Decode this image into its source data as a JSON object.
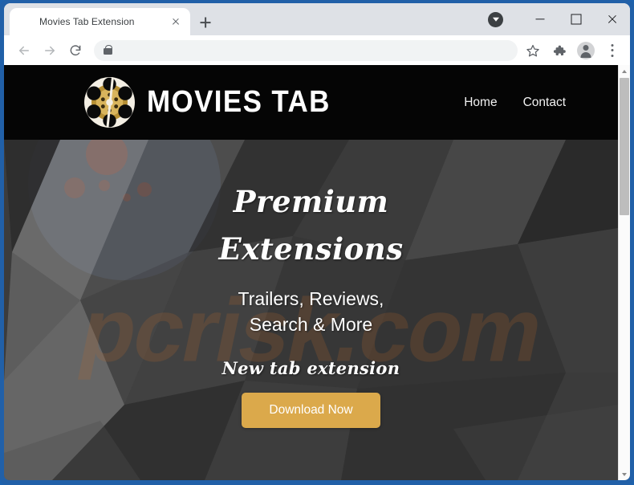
{
  "browser": {
    "tab": {
      "title": "Movies Tab Extension",
      "favicon": "film-reel-icon",
      "close_label": "×"
    },
    "new_tab_label": "+",
    "window_controls": {
      "download_badge": "download-indicator",
      "minimize": "–",
      "maximize": "□",
      "close": "×"
    },
    "toolbar": {
      "back": "back-arrow",
      "forward": "forward-arrow",
      "reload": "reload-arrow",
      "omnibox_value": "",
      "omnibox_placeholder": "",
      "lock": "lock-icon",
      "bookmark": "star-icon",
      "extensions": "puzzle-icon",
      "profile": "profile-avatar",
      "menu": "three-dot-menu"
    }
  },
  "site": {
    "brand": {
      "name": "MOVIES TAB",
      "logo": "film-reel-logo"
    },
    "nav": [
      {
        "label": "Home"
      },
      {
        "label": "Contact"
      }
    ],
    "hero": {
      "headline_line1": "Premium",
      "headline_line2": "Extensions",
      "subtitle_line1": "Trailers, Reviews,",
      "subtitle_line2": "Search & More",
      "tagline": "New tab extension",
      "cta_label": "Download Now",
      "watermark": "pcrisk.com"
    }
  },
  "scrollbar": {
    "up_arrow": "scroll-up-arrow",
    "down_arrow": "scroll-down-arrow"
  },
  "colors": {
    "window_frame": "#2160a8",
    "tabstrip": "#dee1e6",
    "site_header": "#050505",
    "hero_bg": "#3d3d3d",
    "cta": "#dba94b",
    "brand_gold": "#d8b45c",
    "watermark": "#be6928"
  }
}
